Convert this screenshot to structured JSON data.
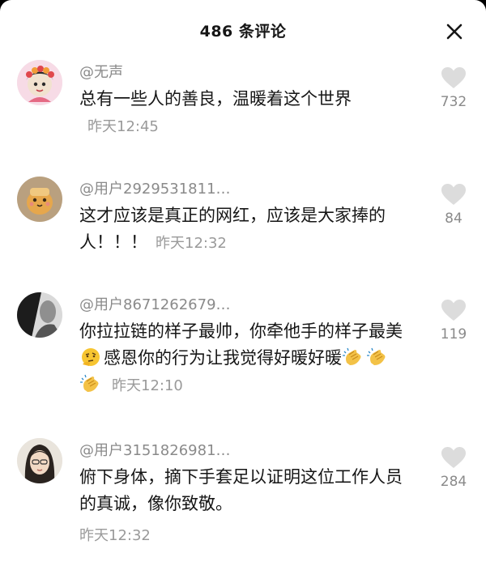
{
  "header": {
    "title": "486 条评论"
  },
  "comments": [
    {
      "username": "@无声",
      "text": "总有一些人的善良，温暖着这个世界",
      "time": "昨天12:45",
      "likes": "732",
      "avatar_icon": "cartoon-girl-avatar"
    },
    {
      "username": "@用户2929531811…",
      "text": "这才应该是真正的网红，应该是大家捧的人！！！",
      "time": "昨天12:32",
      "likes": "84",
      "avatar_icon": "bread-character-avatar"
    },
    {
      "username": "@用户8671262679…",
      "text_before_emoji": "你拉拉链的样子最帅，你牵他手的样子最美",
      "text_after_emoji": "感恩你的行为让我觉得好暖好暖",
      "emojis": [
        "thinking-face-emoji",
        "clapping-hands-emoji",
        "clapping-hands-emoji",
        "clapping-hands-emoji"
      ],
      "time": "昨天12:10",
      "likes": "119",
      "avatar_icon": "grayscale-photo-avatar"
    },
    {
      "username": "@用户3151826981…",
      "text": "俯下身体，摘下手套足以证明这位工作人员的真诚，像你致敬。",
      "time": "昨天12:32",
      "likes": "284",
      "avatar_icon": "woman-photo-avatar"
    }
  ],
  "colors": {
    "background": "#ffffff",
    "primary_text": "#161616",
    "secondary_text": "#8a8a8a",
    "heart_icon": "#dcdcdc"
  }
}
